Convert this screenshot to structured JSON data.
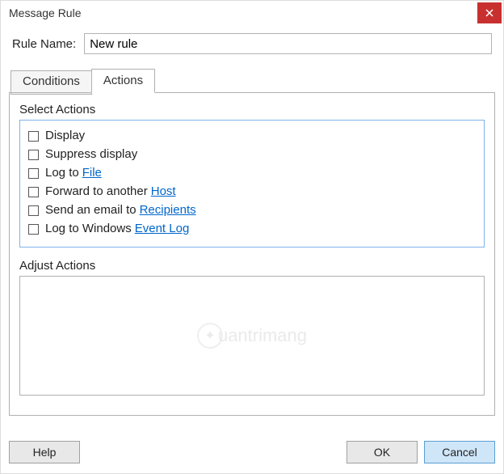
{
  "title": "Message Rule",
  "ruleName": {
    "label": "Rule Name:",
    "value": "New rule"
  },
  "tabs": {
    "conditions": "Conditions",
    "actions": "Actions"
  },
  "selectActions": {
    "label": "Select Actions",
    "items": [
      {
        "pre": "Display",
        "link": ""
      },
      {
        "pre": "Suppress display",
        "link": ""
      },
      {
        "pre": "Log to ",
        "link": "File"
      },
      {
        "pre": "Forward to another ",
        "link": "Host"
      },
      {
        "pre": "Send an email to ",
        "link": "Recipients"
      },
      {
        "pre": "Log to Windows ",
        "link": "Event Log"
      }
    ]
  },
  "adjustActions": {
    "label": "Adjust Actions"
  },
  "watermark": "uantrimang",
  "buttons": {
    "help": "Help",
    "ok": "OK",
    "cancel": "Cancel"
  }
}
